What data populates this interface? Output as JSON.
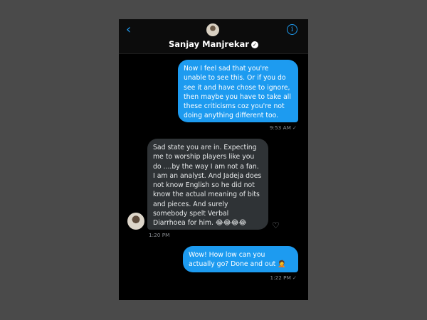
{
  "header": {
    "back_icon": "chevron-left-icon",
    "info_icon": "info-icon",
    "contact_name": "Sanjay Manjrekar",
    "verified_icon": "verified-badge-icon"
  },
  "messages": [
    {
      "direction": "outgoing",
      "text": "Now I feel sad that you're unable to see this. Or if you do see it and have chose to ignore, then maybe you have to take all these criticisms coz you're not doing anything different too.",
      "time": "9:53 AM",
      "status": "✓"
    },
    {
      "direction": "incoming",
      "text": "Sad state you are in. Expecting me to worship players like you do ....by the way I am not a fan. I am an analyst. And Jadeja does not know English so he did not know the actual meaning of bits and pieces. And surely somebody spelt Verbal Diarrhoea for him. 😂😂😂😂",
      "time": "1:20 PM"
    },
    {
      "direction": "outgoing",
      "text": "Wow! How low can you actually go? Done and out 🤦",
      "time": "1:22 PM",
      "status": "✓"
    }
  ],
  "colors": {
    "outgoing_bubble": "#1d9bf0",
    "incoming_bubble": "#2f3336",
    "background": "#000000",
    "accent": "#1e9bf0"
  }
}
